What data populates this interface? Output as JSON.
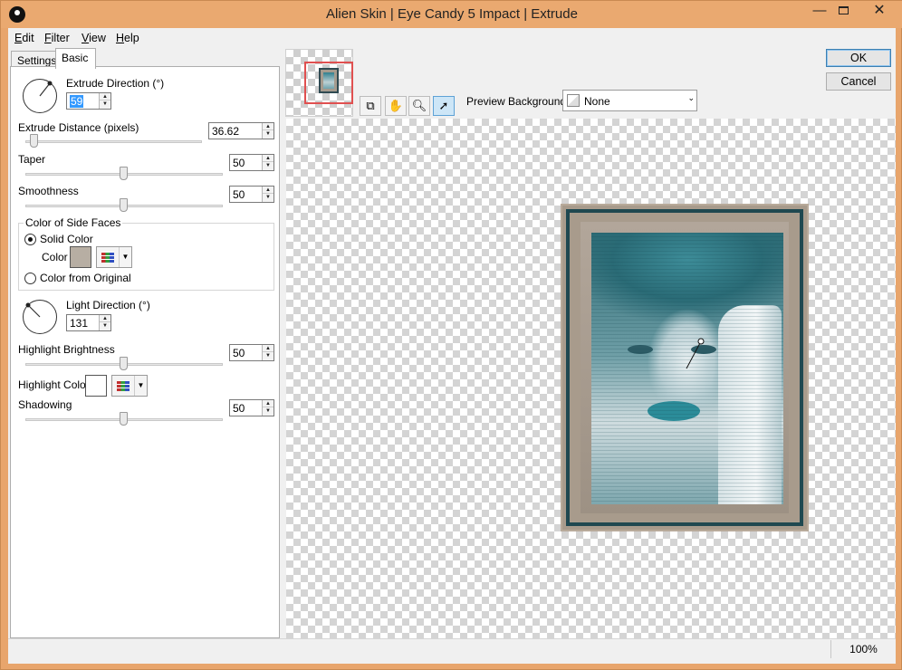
{
  "window": {
    "title": "Alien Skin | Eye Candy 5 Impact | Extrude",
    "minimize_label": "—",
    "close_label": "✕"
  },
  "menu": {
    "items": [
      {
        "label": "Edit",
        "accel": "E",
        "rest": "dit"
      },
      {
        "label": "Filter",
        "accel": "F",
        "rest": "ilter"
      },
      {
        "label": "View",
        "accel": "V",
        "rest": "iew"
      },
      {
        "label": "Help",
        "accel": "H",
        "rest": "elp"
      }
    ]
  },
  "tabs": [
    {
      "label": "Settings",
      "selected": false
    },
    {
      "label": "Basic",
      "selected": true
    }
  ],
  "basic": {
    "extrude_direction": {
      "label": "Extrude Direction (°)",
      "value": "59"
    },
    "extrude_distance": {
      "label": "Extrude Distance (pixels)",
      "value": "36.62",
      "slider_fraction": 0.05
    },
    "taper": {
      "label": "Taper",
      "value": "50",
      "slider_fraction": 0.5
    },
    "smoothness": {
      "label": "Smoothness",
      "value": "50",
      "slider_fraction": 0.5
    },
    "side_faces": {
      "title": "Color of Side Faces",
      "solid_label": "Solid Color",
      "color_label": "Color",
      "original_label": "Color from Original",
      "selected": "Solid Color",
      "color": "#b7aea3"
    },
    "light_direction": {
      "label": "Light Direction (°)",
      "value": "131"
    },
    "highlight_brightness": {
      "label": "Highlight Brightness",
      "value": "50",
      "slider_fraction": 0.5
    },
    "highlight_color": {
      "label": "Highlight Color",
      "color": "#ffffff"
    },
    "shadowing": {
      "label": "Shadowing",
      "value": "50",
      "slider_fraction": 0.5
    }
  },
  "preview": {
    "background_label": "Preview Background:",
    "background_value": "None",
    "tools": [
      "navigate-icon",
      "hand-icon",
      "zoom-icon",
      "pointer-icon"
    ],
    "active_tool": "pointer-icon"
  },
  "buttons": {
    "ok": "OK",
    "cancel": "Cancel"
  },
  "status": {
    "zoom": "100%"
  }
}
